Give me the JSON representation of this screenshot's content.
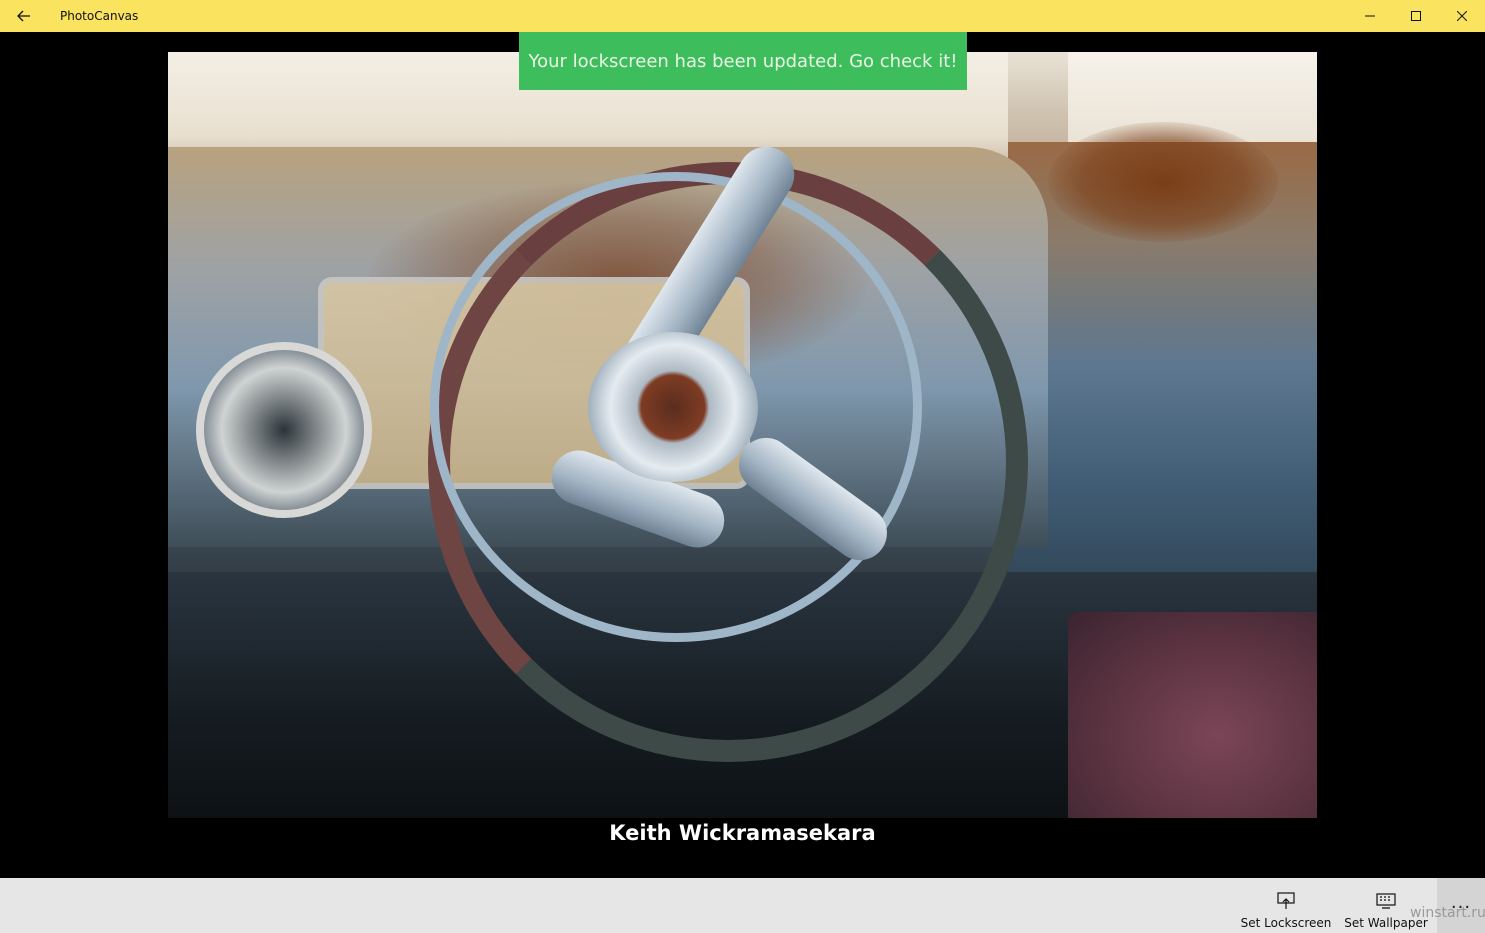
{
  "window": {
    "title": "PhotoCanvas",
    "back_icon": "back-arrow-icon",
    "controls": [
      "minimize-icon",
      "maximize-icon",
      "close-icon"
    ],
    "accent_color": "#f9e35f"
  },
  "toast": {
    "message": "Your lockscreen has been updated. Go check it!",
    "color": "#3dbd5c"
  },
  "photo": {
    "author": "Keith Wickramasekara"
  },
  "appbar": {
    "buttons": [
      {
        "label": "Set Lockscreen",
        "icon": "lockscreen-icon"
      },
      {
        "label": "Set Wallpaper",
        "icon": "wallpaper-icon"
      }
    ],
    "more_label": "..."
  },
  "watermark": "winstart.ru"
}
